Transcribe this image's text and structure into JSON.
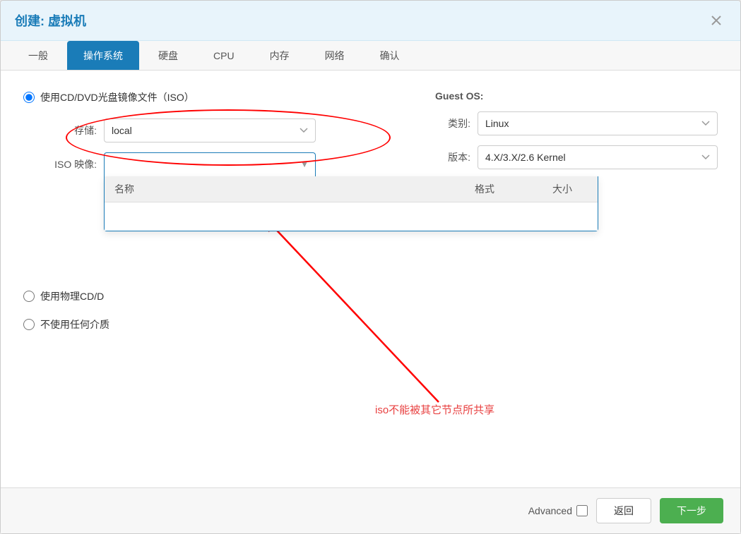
{
  "dialog": {
    "title": "创建: 虚拟机"
  },
  "tabs": [
    {
      "label": "一般",
      "active": false
    },
    {
      "label": "操作系统",
      "active": true
    },
    {
      "label": "硬盘",
      "active": false
    },
    {
      "label": "CPU",
      "active": false
    },
    {
      "label": "内存",
      "active": false
    },
    {
      "label": "网络",
      "active": false
    },
    {
      "label": "确认",
      "active": false
    }
  ],
  "options": {
    "use_iso_label": "使用CD/DVD光盘镜像文件（ISO）",
    "use_physical_label": "使用物理CD/D",
    "no_media_label": "不使用任何介质"
  },
  "storage_label": "存储:",
  "storage_value": "local",
  "iso_label": "ISO 映像:",
  "dropdown": {
    "col_name": "名称",
    "col_format": "格式",
    "col_size": "大小"
  },
  "guest_os": {
    "title": "Guest OS:",
    "category_label": "类别:",
    "category_value": "Linux",
    "version_label": "版本:",
    "version_value": "4.X/3.X/2.6 Kernel"
  },
  "annotation": {
    "text": "iso不能被其它节点所共享"
  },
  "footer": {
    "advanced_label": "Advanced",
    "back_label": "返回",
    "next_label": "下一步"
  }
}
